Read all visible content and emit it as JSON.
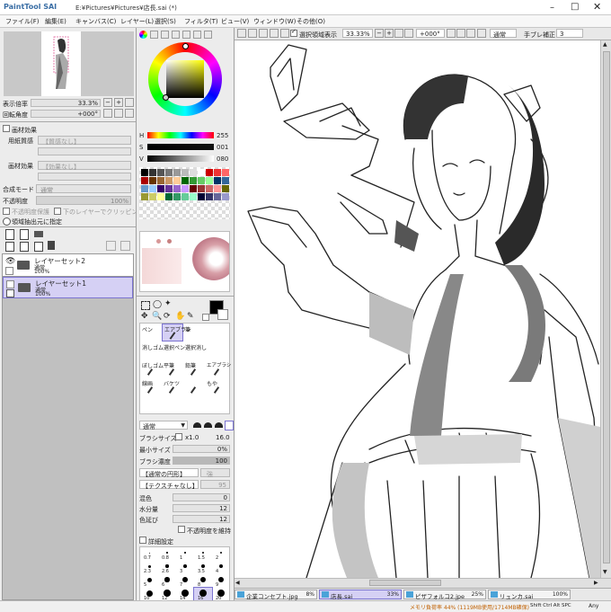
{
  "app": {
    "logo": "PaintTool SAI",
    "path": "E:¥Pictures¥Pictures¥店長.sai (*)"
  },
  "menu": [
    "ファイル(F)",
    "編集(E)",
    "キャンバス(C)",
    "レイヤー(L)",
    "選択(S)",
    "フィルタ(T)",
    "ビュー(V)",
    "ウィンドウ(W)",
    "その他(O)"
  ],
  "navigator": {
    "zoom_label": "表示倍率",
    "zoom_value": "33.3%",
    "angle_label": "回転角度",
    "angle_value": "+000°"
  },
  "layer_props": {
    "paper_effect": "画材効果",
    "paper_texture": "用紙質感",
    "paper_texture_val": "【質感なし】",
    "paper_effect2": "画材効果",
    "paper_effect2_val": "【効果なし】",
    "blend_label": "合成モード",
    "blend_val": "通常",
    "opacity_label": "不透明度",
    "opacity_val": "100%",
    "protect": "不透明度保護",
    "clip": "下のレイヤーでクリッピング",
    "select_src": "領域抽出元に指定"
  },
  "layers": [
    {
      "name": "レイヤーセット2",
      "mode": "通常",
      "opacity": "100%"
    },
    {
      "name": "レイヤーセット1",
      "mode": "通常",
      "opacity": "100%"
    }
  ],
  "color": {
    "h_label": "H",
    "h_val": "255",
    "s_label": "S",
    "s_val": "001",
    "v_label": "V",
    "v_val": "080"
  },
  "tools": {
    "rows": [
      [
        "ペン",
        "エアブラシ",
        "筆"
      ],
      [
        "消しゴム",
        "選択ペン",
        "選択消し"
      ],
      [
        "ぼしゴム",
        "平筆",
        "鉛筆",
        "エアブラシ"
      ],
      [
        "線画",
        "バケツ",
        "",
        "もや"
      ]
    ],
    "mode": "通常",
    "brush_size_label": "ブラシサイズ",
    "brush_size_mult": "x1.0",
    "brush_size_val": "16.0",
    "min_size_label": "最小サイズ",
    "min_size_val": "0%",
    "density_label": "ブラシ濃度",
    "density_val": "100",
    "shape": "【通常の円形】",
    "shape_val": "強",
    "texture": "【テクスチャなし】",
    "texture_val": "95",
    "mix_label": "混色",
    "mix_val": "0",
    "water_label": "水分量",
    "water_val": "12",
    "stretch_label": "色延び",
    "stretch_val": "12",
    "keep_opacity": "不透明度を維持",
    "detail": "詳細設定",
    "sizes": [
      "0.7",
      "0.8",
      "1",
      "1.5",
      "2",
      "2.3",
      "2.6",
      "3",
      "3.5",
      "4",
      "5",
      "6",
      "7",
      "8",
      "9",
      "10",
      "12",
      "14",
      "16",
      "20"
    ]
  },
  "canvas_toolbar": {
    "select_label": "選択領域表示",
    "zoom": "33.33%",
    "angle": "+000°",
    "mode": "通常",
    "stabilizer_label": "手ブレ補正",
    "stabilizer_val": "3"
  },
  "tabs": [
    {
      "label": "企業コンセプト.jpg",
      "zoom": "8%"
    },
    {
      "label": "店長.sai",
      "zoom": "33%"
    },
    {
      "label": "ピザフォルコ2.jpe",
      "zoom": "25%"
    },
    {
      "label": "リュンカ.sai",
      "zoom": "100%"
    }
  ],
  "status": {
    "memory": "メモリ負荷率 44% (1119MB使用/1714MB確保)",
    "keys": "Shift Ctrl Alt SPC",
    "any": "Any"
  }
}
